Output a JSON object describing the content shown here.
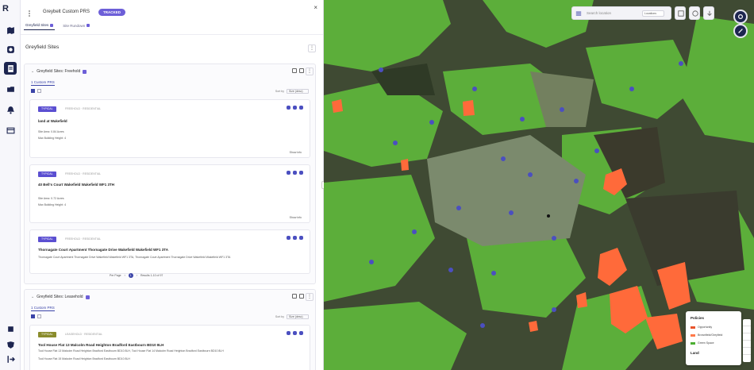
{
  "app": {
    "logo": "R"
  },
  "rail": {
    "items": [
      {
        "name": "sites-icon"
      },
      {
        "name": "map-icon"
      },
      {
        "name": "layers-icon"
      },
      {
        "name": "notes-icon"
      },
      {
        "name": "folder-icon"
      },
      {
        "name": "bell-icon"
      },
      {
        "name": "table-icon"
      }
    ],
    "bottom": [
      {
        "name": "settings-icon"
      },
      {
        "name": "shield-icon"
      },
      {
        "name": "logout-icon"
      }
    ]
  },
  "panel": {
    "title": "Greybelt Custom PRS",
    "badge": "TRACKED",
    "tabs": [
      {
        "label": "Greyfield Sites"
      },
      {
        "label": "Site Rundown"
      }
    ]
  },
  "section": {
    "title": "Greyfield Sites"
  },
  "group1": {
    "title": "Greyfield Sites: Freehold",
    "subtab": "1 Custom PRS",
    "sort_label": "Sort by",
    "sort_value": "Size (desc)",
    "cards": [
      {
        "status": "TYPICAL",
        "meta": "FREEHOLD · RESIDENTIAL",
        "title": "land at Wakefield",
        "lines": [
          "Site Area: 0.84 Acres",
          "Max Building Height: 4"
        ],
        "show": "Show info"
      },
      {
        "status": "TYPICAL",
        "meta": "FREEHOLD · RESIDENTIAL",
        "title": "40 Bell's Court Wakefield Wakefield WF1 3TH",
        "lines": [
          "Site Area: 0.72 Acres",
          "Max Building Height: 4"
        ],
        "show": "Show info"
      },
      {
        "status": "TYPICAL",
        "meta": "FREEHOLD · RESIDENTIAL",
        "title": "Thornagate Court Apartment Thornagate Drive Wakefield Wakefield WF1 3TA",
        "lines": [
          "Thornagate Court Apartment Thornagate Drive Wakefield Wakefield WF1 3TA, Thornagate Court Apartment Thornagate Drive Wakefield Wakefield WF1 3TA"
        ],
        "show": ""
      }
    ],
    "pager": {
      "per_page_label": "Per Page",
      "page": "1",
      "range": "Results 1-10 of 97"
    }
  },
  "group2": {
    "title": "Greyfield Sites: Leasehold",
    "subtab": "1 Custom PRS",
    "sort_label": "Sort by",
    "sort_value": "Size (desc)",
    "cards": [
      {
        "status": "TYPICAL",
        "meta": "LEASEHOLD · RESIDENTIAL",
        "title": "Tool House Flat 13 Malcolm Road Heighton Bradford Eastbourn BD10 8LH",
        "lines": [
          "Tool House Flat 13 Malcolm Road Heighton Bradford Eastbourn BD10 8LH, Tool House Flat 14 Malcolm Road Heighton Bradford Eastbourn BD10 8LH",
          "Tool House Flat 15 Malcolm Road Heighton Bradford Eastbourn BD10 8LH"
        ]
      }
    ]
  },
  "map": {
    "search_placeholder": "Search location",
    "search_scope": "Locations",
    "legend": {
      "title": "Policies",
      "items": [
        {
          "label": "Opportunity",
          "color": "#e8542c"
        },
        {
          "label": "Brownfield/Greyfield",
          "color": "#ff7a4a"
        },
        {
          "label": "Green Space",
          "color": "#4caf32"
        }
      ],
      "title2": "Land"
    },
    "colors": {
      "green": "#5cae3a",
      "urban": "#7b8a6d",
      "orange": "#ff6a3a"
    }
  }
}
